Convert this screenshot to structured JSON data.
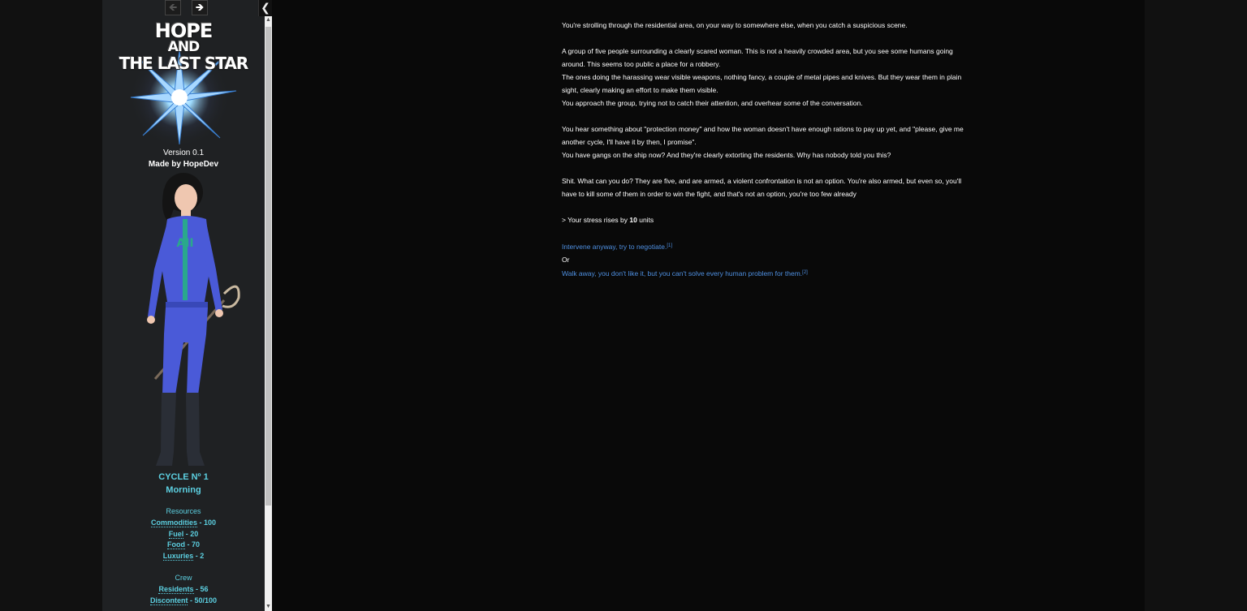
{
  "nav": {
    "back_icon": "arrow-left-icon",
    "forward_icon": "arrow-right-icon",
    "toggle_icon": "chevron-left-icon"
  },
  "sidebar": {
    "logo": {
      "line1": "HOPE",
      "line2": "AND",
      "line3": "THE LAST STAR"
    },
    "version": "Version 0.1",
    "author": "Made by HopeDev",
    "cycle": "CYCLE Nº 1",
    "time_of_day": "Morning",
    "resources": {
      "title": "Resources",
      "items": [
        {
          "label": "Commodities",
          "value": " - 100"
        },
        {
          "label": "Fuel",
          "value": " - 20"
        },
        {
          "label": "Food",
          "value": " - 70"
        },
        {
          "label": "Luxuries",
          "value": " - 2"
        }
      ]
    },
    "crew": {
      "title": "Crew",
      "items": [
        {
          "label": "Residents",
          "value": " - 56"
        },
        {
          "label": "Discontent",
          "value": " - 50/100"
        }
      ]
    }
  },
  "passage": {
    "p1": "You're strolling through the residential area, on your way to somewhere else, when you catch a suspicious scene.",
    "p2": [
      "A group of five people surrounding a clearly scared woman. This is not a heavily crowded area, but you see some humans going around. This seems too public a place for a robbery.",
      "The ones doing the harassing wear visible weapons, nothing fancy, a couple of metal pipes and knives. But they wear them in plain sight, clearly making an effort to make them visible.",
      "You approach the group, trying not to catch their attention, and overhear some of the conversation."
    ],
    "p3": [
      "You hear something about \"protection money\" and how the woman doesn't have enough rations to pay up yet, and \"please, give me another cycle, I'll have it by then, I promise\".",
      "You have gangs on the ship now? And they're clearly extorting the residents. Why has nobody told you this?"
    ],
    "p4": "Shit. What can you do? They are five, and are armed, a violent confrontation is not an option. You're also armed, but even so, you'll have to kill some of them in order to win the fight, and that's not an option, you're too few already",
    "stress": {
      "prefix": "> Your stress rises by ",
      "amount": "10",
      "suffix": " units"
    },
    "choices": [
      {
        "text": "Intervene anyway, try to negotiate.",
        "ref": "[1]"
      },
      {
        "text": "Walk away, you don't like it, but you can't solve every human problem for them.",
        "ref": "[2]"
      }
    ],
    "or": "Or"
  },
  "colors": {
    "accent": "#5ccfe0",
    "link": "#4e8fe0",
    "sidebar_bg": "#1f2123",
    "main_bg": "#090909"
  }
}
